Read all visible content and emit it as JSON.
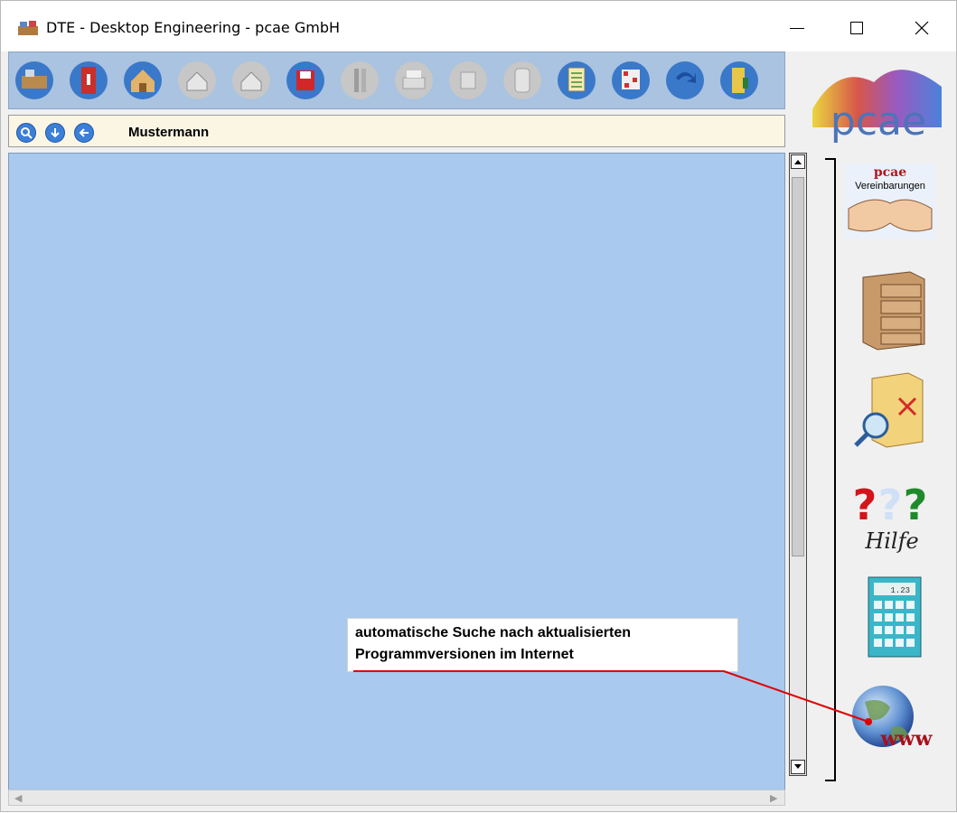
{
  "window": {
    "title": "DTE - Desktop Engineering - pcae GmbH",
    "controls": {
      "minimize": "minimize",
      "maximize": "maximize",
      "close": "close"
    }
  },
  "toolbar": {
    "buttons": [
      {
        "name": "desk-icon",
        "enabled": true
      },
      {
        "name": "ring-binder-icon",
        "enabled": true
      },
      {
        "name": "house-icon",
        "enabled": true
      },
      {
        "name": "house-outline-icon",
        "enabled": false
      },
      {
        "name": "house-outline-2-icon",
        "enabled": false
      },
      {
        "name": "save-icon",
        "enabled": true
      },
      {
        "name": "tools-icon",
        "enabled": false
      },
      {
        "name": "printer-icon",
        "enabled": false
      },
      {
        "name": "puzzle-icon",
        "enabled": false
      },
      {
        "name": "cylinder-icon",
        "enabled": false
      },
      {
        "name": "notepad-icon",
        "enabled": true
      },
      {
        "name": "network-icon",
        "enabled": true
      },
      {
        "name": "redo-arrow-icon",
        "enabled": true
      },
      {
        "name": "exit-door-icon",
        "enabled": true
      }
    ]
  },
  "searchbar": {
    "label": "Mustermann",
    "icons": [
      "magnifier-icon",
      "arrow-down-icon",
      "arrow-left-icon"
    ]
  },
  "side": {
    "logo_text": "pcae",
    "vereinbarungen_brand": "pcae",
    "vereinbarungen_label": "Vereinbarungen",
    "help_label": "Hilfe",
    "calc_display": "1.23",
    "www_label": "www"
  },
  "callout": {
    "line1": "automatische Suche nach aktualisierten",
    "line2": "Programmversionen im Internet"
  },
  "colors": {
    "workarea": "#a9c9ee",
    "toolbar": "#a9c3e0",
    "searchbar": "#fbf6e4",
    "callout_line": "#e00000"
  }
}
